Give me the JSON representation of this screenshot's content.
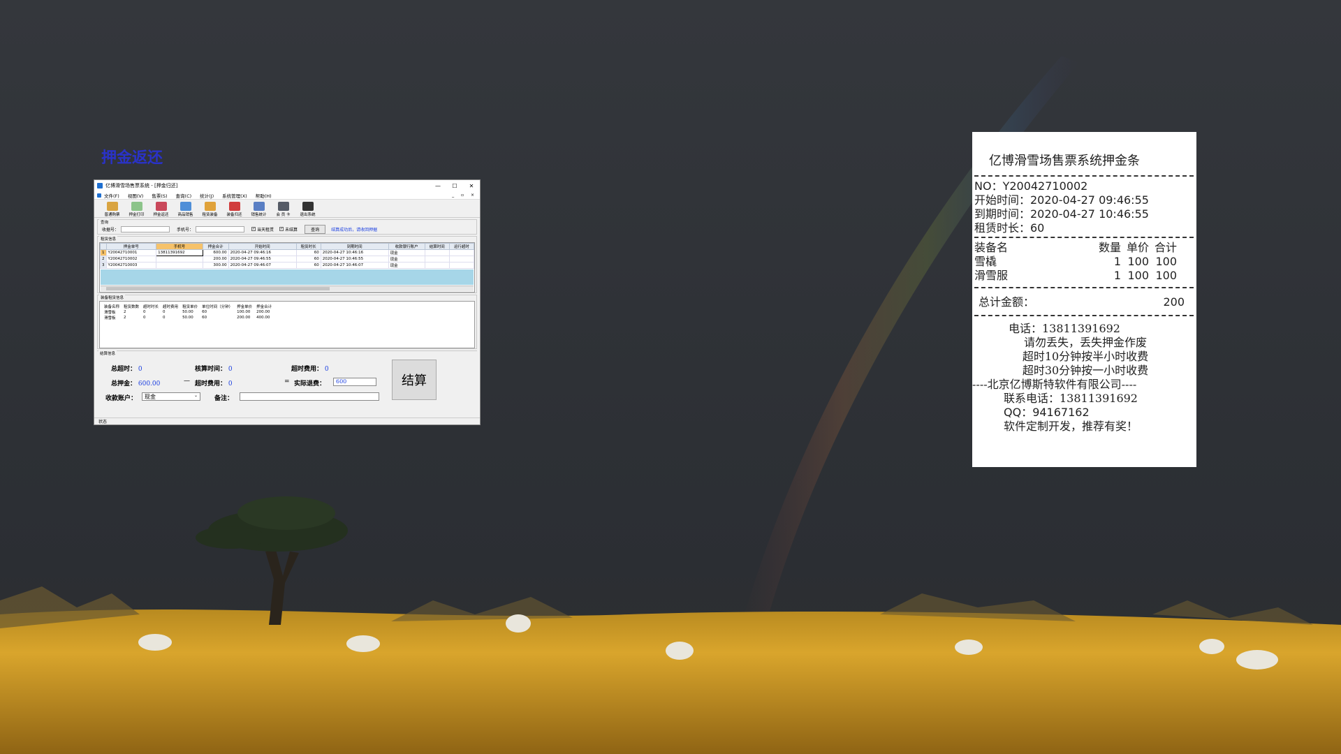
{
  "heading": "押金返还",
  "window": {
    "title": "亿博滑雪场售票系统 - [押金归还]",
    "controls": [
      "—",
      "☐",
      "✕"
    ],
    "mdi_controls": "_ ▫ ×",
    "menu": [
      "文件(F)",
      "视图(V)",
      "售票(S)",
      "查询(C)",
      "统计(J)",
      "系统管理(X)",
      "帮助(H)"
    ],
    "toolbar": [
      {
        "label": "普通购票",
        "color": "#d9a441"
      },
      {
        "label": "押金打印",
        "color": "#8cc48a"
      },
      {
        "label": "押金返还",
        "color": "#c9485b"
      },
      {
        "label": "商品销售",
        "color": "#4f8fd8"
      },
      {
        "label": "租赁装备",
        "color": "#e0a23a"
      },
      {
        "label": "装备归还",
        "color": "#d13c3c"
      },
      {
        "label": "销售统计",
        "color": "#5a7fc4"
      },
      {
        "label": "会 员 卡",
        "color": "#555b66"
      },
      {
        "label": "退出系统",
        "color": "#333333"
      }
    ],
    "query": {
      "group": "查询",
      "receipt_label": "收据号：",
      "phone_label": "手机号：",
      "today_label": "当天租赁",
      "unsettled_label": "未结算",
      "query_button": "查询",
      "hint": "结算成功后，请收回押据"
    },
    "lease": {
      "group": "租赁信息",
      "columns": [
        "押金单号",
        "手机号",
        "押金合计",
        "开始时间",
        "租赁时长",
        "到期时间",
        "收款银行账户",
        "结算时间",
        "运行超时"
      ],
      "rows": [
        [
          "Y20042710001",
          "13811391692",
          "600.00",
          "2020-04-27 09:46:16",
          "60",
          "2020-04-27 10:46:16",
          "现金",
          "",
          ""
        ],
        [
          "Y20042710002",
          "",
          "200.00",
          "2020-04-27 09:46:55",
          "60",
          "2020-04-27 10:46:55",
          "现金",
          "",
          ""
        ],
        [
          "Y20042710003",
          "",
          "300.00",
          "2020-04-27 09:46:07",
          "60",
          "2020-04-27 10:46:07",
          "现金",
          "",
          ""
        ]
      ]
    },
    "equip": {
      "group": "装备租赁信息",
      "columns": [
        "装备名称",
        "租赁数数",
        "超时时长",
        "超时费用",
        "租赁单价",
        "单位时间（分钟）",
        "押金单价",
        "押金合计"
      ],
      "rows": [
        [
          "滑雪板",
          "2",
          "0",
          "0",
          "50.00",
          "60",
          "100.00",
          "200.00"
        ],
        [
          "滑雪板",
          "2",
          "0",
          "0",
          "50.00",
          "60",
          "200.00",
          "400.00"
        ]
      ]
    },
    "settle": {
      "group": "结算信息",
      "total_overtime_label": "总超时：",
      "total_overtime": "0",
      "calc_time_label": "核算时间：",
      "calc_time": "0",
      "overtime_fee_label": "超时费用：",
      "overtime_fee": "0",
      "deposit_label": "总押金：",
      "deposit": "600.00",
      "minus": "—",
      "overtime_fee2_label": "超时费用：",
      "overtime_fee2": "0",
      "equals": "=",
      "refund_label": "实际退费：",
      "refund": "600",
      "account_label": "收款账户：",
      "account": "现金",
      "note_label": "备注：",
      "calc_button": "结算"
    },
    "status": "状态"
  },
  "receipt": {
    "title": "亿博滑雪场售票系统押金条",
    "no": "NO：Y20042710002",
    "start": "开始时间：2020-04-27 09:46:55",
    "end": "到期时间：2020-04-27 10:46:55",
    "duration": "租赁时长：60",
    "columns": {
      "name": "装备名",
      "qty": "数量",
      "price": "单价",
      "total": "合计"
    },
    "items": [
      {
        "name": "雪橇",
        "qty": "1",
        "price": "100",
        "total": "100"
      },
      {
        "name": "滑雪服",
        "qty": "1",
        "price": "100",
        "total": "100"
      }
    ],
    "total_label": "总计金额：",
    "total": "200",
    "phone": "电话：13811391692",
    "notice1": "请勿丢失，丢失押金作废",
    "notice2": "超时10分钟按半小时收费",
    "notice3": "超时30分钟按一小时收费",
    "company": "----北京亿博斯特软件有限公司----",
    "contact": "联系电话：13811391692",
    "qq": "QQ：94167162",
    "promo": "软件定制开发，推荐有奖！"
  },
  "colors": {
    "heading": "#2a32c8",
    "accent_blue": "#1b3fe0",
    "grid_highlight": "#a6d6e8"
  }
}
